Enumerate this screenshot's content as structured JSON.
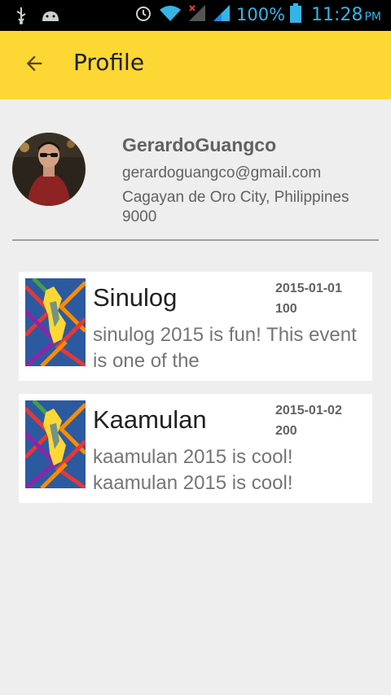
{
  "status_bar": {
    "battery_percent": "100%",
    "time": "11:28",
    "ampm": "PM",
    "icons": [
      "usb-icon",
      "android-icon",
      "alarm-icon",
      "wifi-icon",
      "signal-icon",
      "signal-icon",
      "battery-icon"
    ],
    "accent_color": "#33b5e5"
  },
  "toolbar": {
    "title": "Profile",
    "background": "#fdd835"
  },
  "profile": {
    "name": "GerardoGuangco",
    "email": "gerardoguangco@gmail.com",
    "address": "Cagayan de Oro City, Philippines 9000"
  },
  "events": [
    {
      "title": "Sinulog",
      "date": "2015-01-01",
      "count": "100",
      "description": "sinulog 2015 is fun! This event is one of the"
    },
    {
      "title": "Kaamulan",
      "date": "2015-01-02",
      "count": "200",
      "description": "kaamulan 2015 is cool! kaamulan 2015 is cool!"
    }
  ]
}
